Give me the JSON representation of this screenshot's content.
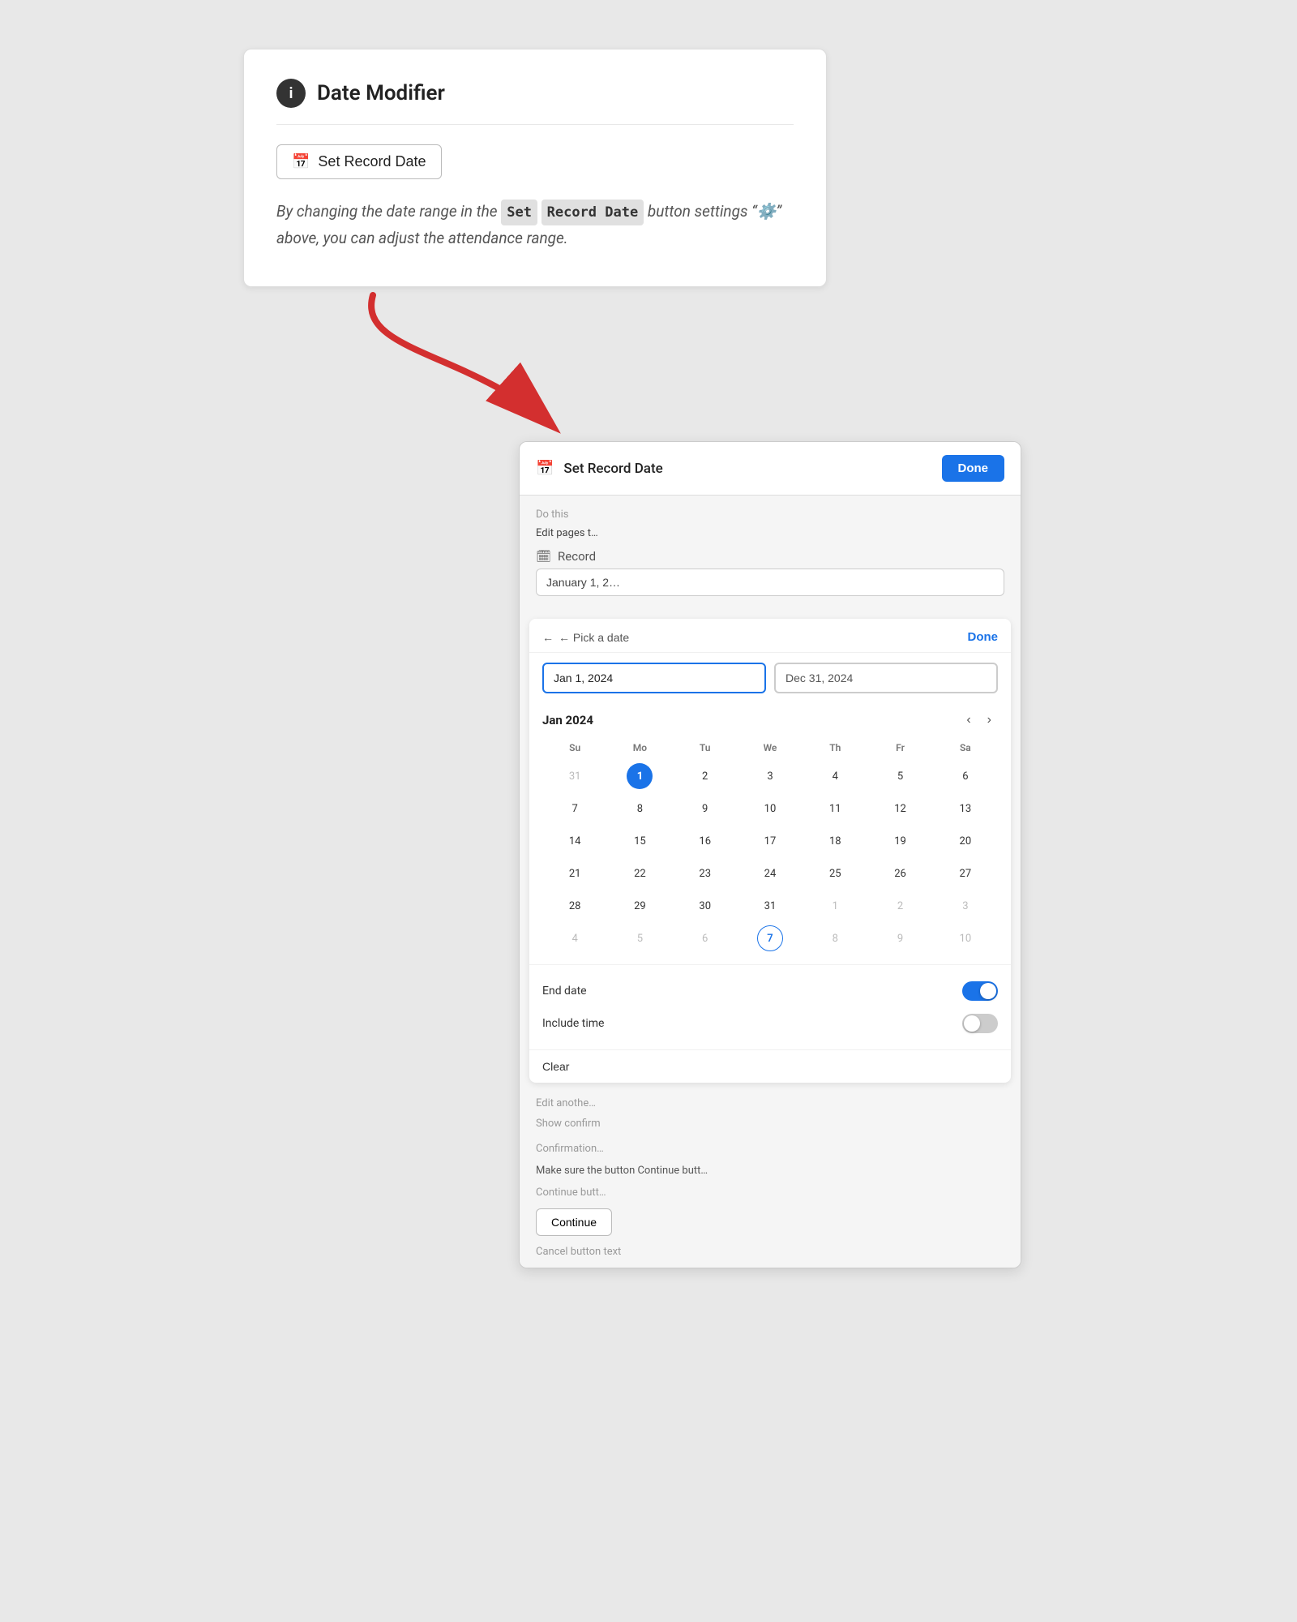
{
  "topCard": {
    "infoIconLabel": "i",
    "title": "Date Modifier",
    "setRecordDateBtn": "Set Record Date",
    "description1": "By changing the date range in the ",
    "badge1": "Set",
    "badge2": "Record Date",
    "description2": " button settings “⚙️” above, you can adjust the attendance range."
  },
  "bottomCard": {
    "headerCalendarIcon": "📅",
    "headerTitle": "Set Record Date",
    "doneBtn": "Done",
    "datePicker": {
      "backLabel": "← Pick a date",
      "doneLabel": "Done",
      "startDate": "Jan 1, 2024",
      "endDate": "Dec 31, 2024",
      "monthLabel": "Jan 2024",
      "weekdays": [
        "Su",
        "Mo",
        "Tu",
        "We",
        "Th",
        "Fr",
        "Sa"
      ],
      "weeks": [
        [
          {
            "day": "31",
            "state": "muted"
          },
          {
            "day": "1",
            "state": "today"
          },
          {
            "day": "2",
            "state": "normal"
          },
          {
            "day": "3",
            "state": "normal"
          },
          {
            "day": "4",
            "state": "normal"
          },
          {
            "day": "5",
            "state": "normal"
          },
          {
            "day": "6",
            "state": "normal"
          }
        ],
        [
          {
            "day": "7",
            "state": "normal"
          },
          {
            "day": "8",
            "state": "normal"
          },
          {
            "day": "9",
            "state": "normal"
          },
          {
            "day": "10",
            "state": "normal"
          },
          {
            "day": "11",
            "state": "normal"
          },
          {
            "day": "12",
            "state": "normal"
          },
          {
            "day": "13",
            "state": "normal"
          }
        ],
        [
          {
            "day": "14",
            "state": "normal"
          },
          {
            "day": "15",
            "state": "normal"
          },
          {
            "day": "16",
            "state": "normal"
          },
          {
            "day": "17",
            "state": "normal"
          },
          {
            "day": "18",
            "state": "normal"
          },
          {
            "day": "19",
            "state": "normal"
          },
          {
            "day": "20",
            "state": "normal"
          }
        ],
        [
          {
            "day": "21",
            "state": "normal"
          },
          {
            "day": "22",
            "state": "normal"
          },
          {
            "day": "23",
            "state": "normal"
          },
          {
            "day": "24",
            "state": "normal"
          },
          {
            "day": "25",
            "state": "normal"
          },
          {
            "day": "26",
            "state": "normal"
          },
          {
            "day": "27",
            "state": "normal"
          }
        ],
        [
          {
            "day": "28",
            "state": "normal"
          },
          {
            "day": "29",
            "state": "normal"
          },
          {
            "day": "30",
            "state": "normal"
          },
          {
            "day": "31",
            "state": "normal"
          },
          {
            "day": "1",
            "state": "muted"
          },
          {
            "day": "2",
            "state": "muted"
          },
          {
            "day": "3",
            "state": "muted"
          }
        ],
        [
          {
            "day": "4",
            "state": "muted"
          },
          {
            "day": "5",
            "state": "muted"
          },
          {
            "day": "6",
            "state": "muted"
          },
          {
            "day": "7",
            "state": "selected-outline"
          },
          {
            "day": "8",
            "state": "muted"
          },
          {
            "day": "9",
            "state": "muted"
          },
          {
            "day": "10",
            "state": "muted"
          }
        ]
      ],
      "endDateToggleLabel": "End date",
      "endDateToggleOn": true,
      "includeTimeLabel": "Include time",
      "includeTimeOn": false,
      "clearLabel": "Clear"
    },
    "behindContent": {
      "doThisLabel": "Do this",
      "editPagesText": "Edit pages t…",
      "recordLabel": "Record",
      "recordDateInput": "January 1, 2…",
      "editAnotherText": "Edit anothe…",
      "showConfirmLabel": "Show confirm",
      "confirmationLabel": "Confirmation…",
      "makeSureText": "Make sure the button Continue butt…",
      "continueButtonLabel": "Continue butt…",
      "continueBtn": "Continue",
      "cancelBtnText": "Cancel button text"
    }
  }
}
